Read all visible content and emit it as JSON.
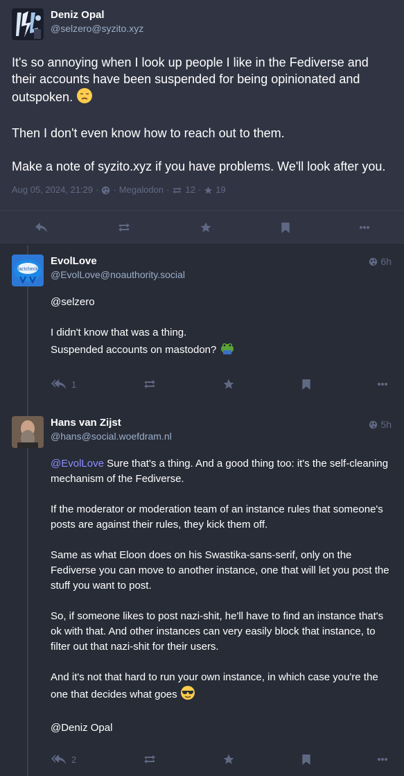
{
  "main": {
    "author": {
      "display_name": "Deniz Opal",
      "handle": "@selzero@syzito.xyz"
    },
    "paragraphs": [
      "It's so annoying when I look up people I like in the Fediverse and their accounts have been suspended for being opinionated and outspoken.",
      "Then I don't even know how to reach out to them.",
      "Make a note of  syzito.xyz if you have problems. We'll look after you."
    ],
    "emoji_p1": "disappointed-face",
    "meta": {
      "date": "Aug 05, 2024, 21:29",
      "separator": "·",
      "app": "Megalodon",
      "boosts": "12",
      "favourites": "19"
    }
  },
  "replies": [
    {
      "author": {
        "display_name": "EvolLove",
        "handle": "@EvolLove@noauthority.social"
      },
      "avatar_text": "factcheck",
      "time": "6h",
      "paragraphs": [
        "@selzero"
      ],
      "line2a": "I didn't know that was a thing.",
      "line2b": "Suspended accounts on mastodon?",
      "emoji": "frog",
      "reply_count": "1"
    },
    {
      "author": {
        "display_name": "Hans van Zijst",
        "handle": "@hans@social.woefdram.nl"
      },
      "time": "5h",
      "mention": "@EvolLove",
      "p1_rest": " Sure that's a thing. And a good thing too: it's the self-cleaning mechanism of the Fediverse.",
      "p2": "If the moderator or moderation team of an instance rules that someone's posts are against their rules, they kick them off.",
      "p3": "Same as what Eloon does on his Swastika-sans-serif, only on the Fediverse you can move to another instance, one that will let you post the stuff you want to post.",
      "p4": "So, if someone likes to post nazi-shit, he'll have to find an instance that's ok with that. And other instances can very easily block that instance, to filter out that nazi-shit for their users.",
      "p5": "And it's not that hard to run your own instance, in which case you're the one that decides what goes",
      "p6": "@Deniz Opal",
      "emoji": "sunglasses-face",
      "reply_count": "2"
    }
  ],
  "colors": {
    "bg": "#282c37",
    "main_bg": "#313543",
    "muted": "#606984",
    "handle": "#9baec8",
    "mention": "#8c8dff"
  },
  "icons": [
    "reply-icon",
    "boost-icon",
    "star-icon",
    "bookmark-icon",
    "more-icon",
    "globe-icon"
  ]
}
